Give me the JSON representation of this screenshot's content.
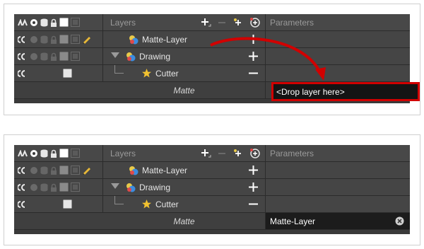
{
  "panels": [
    {
      "header": {
        "layers_label": "Layers",
        "parameters_label": "Parameters"
      },
      "layers": [
        {
          "name": "Matte-Layer"
        },
        {
          "name": "Drawing"
        },
        {
          "name": "Cutter"
        }
      ],
      "matte_row": {
        "label": "Matte",
        "param": "<Drop layer here>"
      }
    },
    {
      "header": {
        "layers_label": "Layers",
        "parameters_label": "Parameters"
      },
      "layers": [
        {
          "name": "Matte-Layer"
        },
        {
          "name": "Drawing"
        },
        {
          "name": "Cutter"
        }
      ],
      "matte_row": {
        "label": "Matte",
        "param": "Matte-Layer"
      }
    }
  ],
  "colors": {
    "highlight": "#d10000",
    "arrow": "#d10000",
    "panel_bg": "#454545"
  }
}
